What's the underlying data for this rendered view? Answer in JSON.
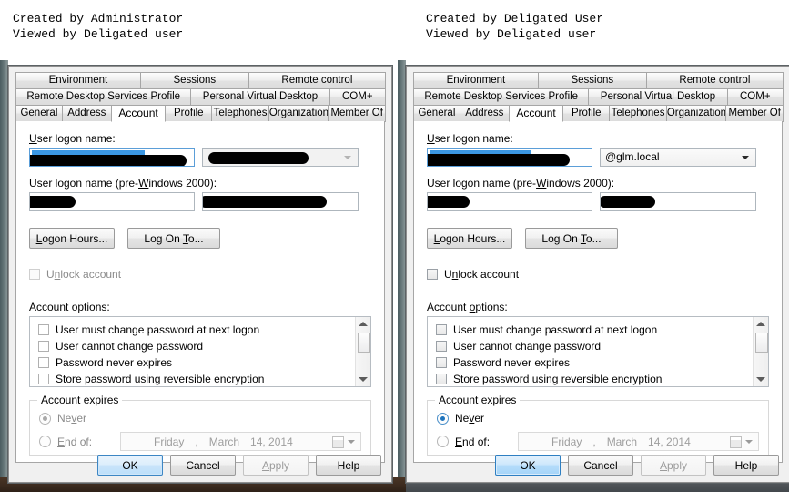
{
  "captions": {
    "left": "Created by Administrator\nViewed by Deligated user",
    "right": "Created by Deligated User\nViewed by Deligated user"
  },
  "tabs": {
    "row1": [
      "Environment",
      "Sessions",
      "Remote control"
    ],
    "row2": [
      "Remote Desktop Services Profile",
      "Personal Virtual Desktop",
      "COM+"
    ],
    "row3": [
      "General",
      "Address",
      "Account",
      "Profile",
      "Telephones",
      "Organization",
      "Member Of"
    ],
    "active": "Account"
  },
  "labels": {
    "user_logon_name": "User logon name:",
    "user_logon_name_pre2000": "User logon name (pre-Windows 2000):",
    "account_options": "Account options:",
    "unlock_account": "Unlock account",
    "account_expires": "Account expires",
    "never": "Never",
    "end_of": "End of:"
  },
  "buttons": {
    "logon_hours": "Logon Hours...",
    "log_on_to": "Log On To...",
    "ok": "OK",
    "cancel": "Cancel",
    "apply": "Apply",
    "help": "Help"
  },
  "account_options": [
    "User must change password at next logon",
    "User cannot change password",
    "Password never expires",
    "Store password using reversible encryption"
  ],
  "date": {
    "day": "Friday",
    "comma": ",",
    "month": "March",
    "daynum_year": "14, 2014"
  },
  "left_panel": {
    "domain_suffix": "",
    "logon_name_value": "",
    "pre2000_domain_value": "",
    "pre2000_name_value": ""
  },
  "right_panel": {
    "domain_suffix": "@glm.local",
    "logon_name_value": "",
    "pre2000_domain_value": "",
    "pre2000_name_value": ""
  },
  "colors": {
    "selection_blue": "#3b97e3",
    "redaction_black": "#000000",
    "default_button_blue": "#3c86c4",
    "disabled_text": "#8b8b8b"
  }
}
